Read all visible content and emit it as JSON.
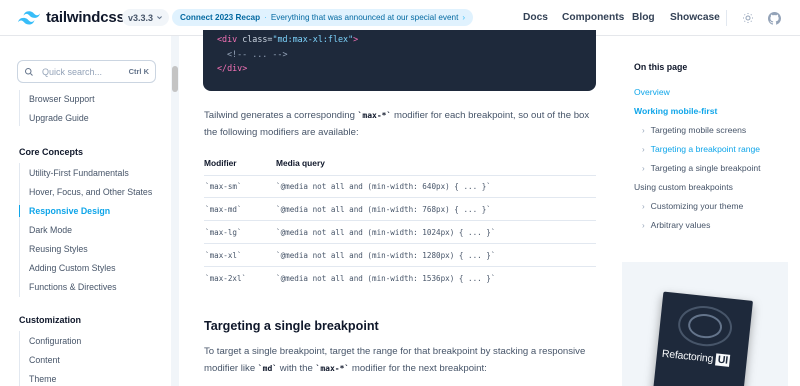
{
  "header": {
    "logo_text": "tailwindcss",
    "version": "v3.3.3",
    "announcement": {
      "strong": "Connect 2023 Recap",
      "sep": "·",
      "text": "Everything that was announced at our special event",
      "arrow": "›"
    },
    "nav": [
      "Docs",
      "Components",
      "Blog",
      "Showcase"
    ]
  },
  "sidebar": {
    "search_placeholder": "Quick search...",
    "search_shortcut": "Ctrl K",
    "items_top": [
      "Browser Support",
      "Upgrade Guide"
    ],
    "core_heading": "Core Concepts",
    "core_items": [
      "Utility-First Fundamentals",
      "Hover, Focus, and Other States",
      "Responsive Design",
      "Dark Mode",
      "Reusing Styles",
      "Adding Custom Styles",
      "Functions & Directives"
    ],
    "custom_heading": "Customization",
    "custom_items": [
      "Configuration",
      "Content",
      "Theme"
    ]
  },
  "code": {
    "line1": {
      "open": "<div",
      "attr": " class=",
      "str": "\"md:max-xl:flex\"",
      "close": ">"
    },
    "line2": "<!-- ... -->",
    "line3": "</div>"
  },
  "main": {
    "para1": {
      "a": "Tailwind generates a corresponding ",
      "code": "`max-*`",
      "b": " modifier for each breakpoint, so out of the box the following modifiers are available:"
    },
    "table": {
      "headers": [
        "Modifier",
        "Media query"
      ],
      "rows": [
        [
          "`max-sm`",
          "`@media not all and (min-width: 640px) { ... }`"
        ],
        [
          "`max-md`",
          "`@media not all and (min-width: 768px) { ... }`"
        ],
        [
          "`max-lg`",
          "`@media not all and (min-width: 1024px) { ... }`"
        ],
        [
          "`max-xl`",
          "`@media not all and (min-width: 1280px) { ... }`"
        ],
        [
          "`max-2xl`",
          "`@media not all and (min-width: 1536px) { ... }`"
        ]
      ]
    },
    "heading2": "Targeting a single breakpoint",
    "para2": {
      "a": "To target a single breakpoint, target the range for that breakpoint by stacking a responsive modifier like ",
      "code1": "`md`",
      "b": " with the ",
      "code2": "`max-*`",
      "c": " modifier for the next breakpoint:"
    }
  },
  "toc": {
    "title": "On this page",
    "items": [
      "Overview",
      "Working mobile-first",
      "Targeting mobile screens",
      "Targeting a breakpoint range",
      "Targeting a single breakpoint",
      "Using custom breakpoints",
      "Customizing your theme",
      "Arbitrary values"
    ],
    "chevron": "›"
  },
  "ad": {
    "title_a": "Refactoring ",
    "title_b": "UI"
  },
  "colors": {
    "accent": "#0ea5e9",
    "code_bg": "#1e293b"
  }
}
